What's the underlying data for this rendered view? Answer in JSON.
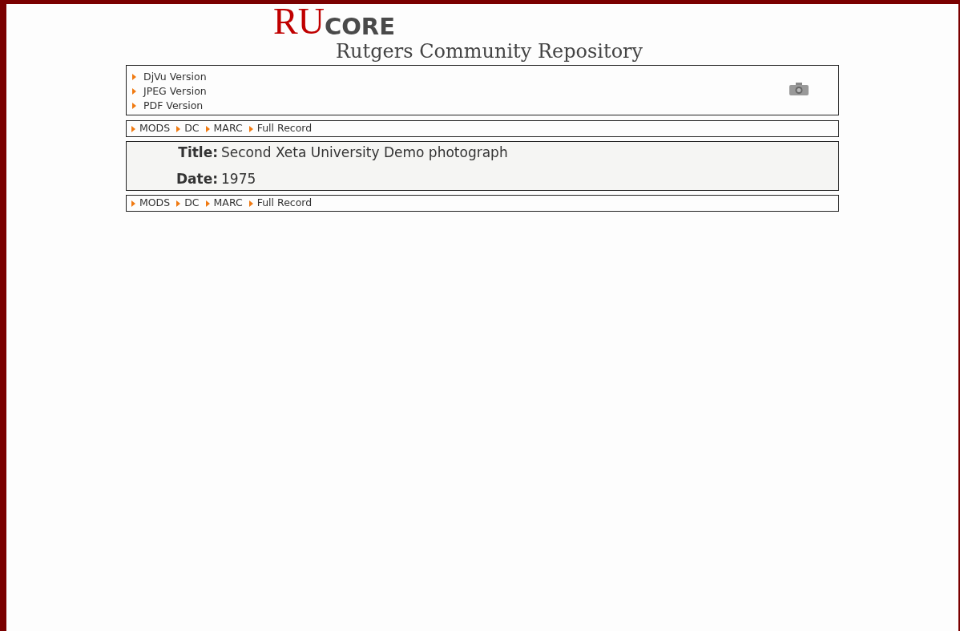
{
  "logo": {
    "mark": "RU",
    "name": "CORE",
    "subtitle": "Rutgers Community Repository"
  },
  "versions": [
    "DjVu Version",
    "JPEG Version",
    "PDF Version"
  ],
  "format_links_top": [
    "MODS",
    "DC",
    "MARC",
    "Full Record"
  ],
  "record": [
    {
      "label": "Title:",
      "value": "Second Xeta University Demo photograph"
    },
    {
      "label": "Date:",
      "value": "1975"
    }
  ],
  "format_links_bottom": [
    "MODS",
    "DC",
    "MARC",
    "Full Record"
  ]
}
